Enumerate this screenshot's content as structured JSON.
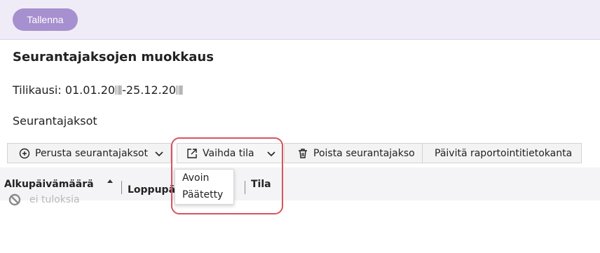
{
  "header": {
    "save_label": "Tallenna"
  },
  "page": {
    "title": "Seurantajaksojen muokkaus",
    "period_label": "Tilikausi:",
    "period_start_prefix": "01.01.20",
    "period_separator": "-25.12.20",
    "section_title": "Seurantajaksot"
  },
  "toolbar": {
    "generate_label": "Perusta seurantajaksot",
    "change_state_label": "Vaihda tila",
    "delete_label": "Poista seurantajakso",
    "update_label": "Päivitä raportointitietokanta"
  },
  "dropdown": {
    "items": [
      {
        "label": "Avoin"
      },
      {
        "label": "Päätetty"
      }
    ]
  },
  "grid": {
    "columns": [
      {
        "label": "Alkupäivämäärä"
      },
      {
        "label": "Loppupäivämäärä"
      },
      {
        "label": "Tila"
      }
    ],
    "empty_text": "ei tuloksia"
  },
  "colors": {
    "accent": "#a690cf",
    "highlight": "#d9535f"
  }
}
